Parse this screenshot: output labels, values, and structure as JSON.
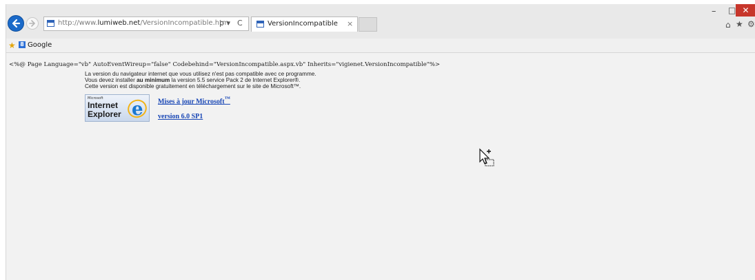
{
  "browser": {
    "address": {
      "url_prefix": "http://www.",
      "url_domain": "lumiweb.net",
      "url_path": "/VersionIncompatible.htm",
      "search_glyph": "ρ ▾",
      "refresh_glyph": "C"
    },
    "tab": {
      "title": "VersionIncompatible",
      "close_glyph": "×"
    },
    "window_controls": {
      "minimize": "–",
      "restore": "□",
      "close": "✕"
    },
    "toolbar_icons": {
      "home": "⌂",
      "favorites": "★",
      "tools": "⚙"
    },
    "favorites_bar": {
      "star_glyph": "★",
      "google_icon_letter": "8",
      "google_label": "Google"
    }
  },
  "page": {
    "aspx_directive": "<%@ Page Language=\"vb\" AutoEventWireup=\"false\" Codebehind=\"VersionIncompatible.aspx.vb\" Inherits=\"vigienet.VersionIncompatible\"%>",
    "message_line1": "La version du navigateur internet que vous utilisez n'est pas compatible avec ce programme.",
    "message_line2_before": "Vous devez installer ",
    "message_line2_bold": "au minimum",
    "message_line2_after": " la version 5.5 service Pack 2 de Internet  Explorer®.",
    "message_line3": "Cette version est disponible gratuitement en téléchargement sur le site de Microsoft™.",
    "ie_logo": {
      "small": "Microsoft",
      "line1": "Internet",
      "line2": "Explorer"
    },
    "link_updates": "Mises à jour Microsoft",
    "link_updates_suffix": "™",
    "link_version": "version 6.0 SP1"
  },
  "colors": {
    "link": "#1846b5",
    "accent": "#1b6ac9",
    "close": "#c7362b"
  }
}
